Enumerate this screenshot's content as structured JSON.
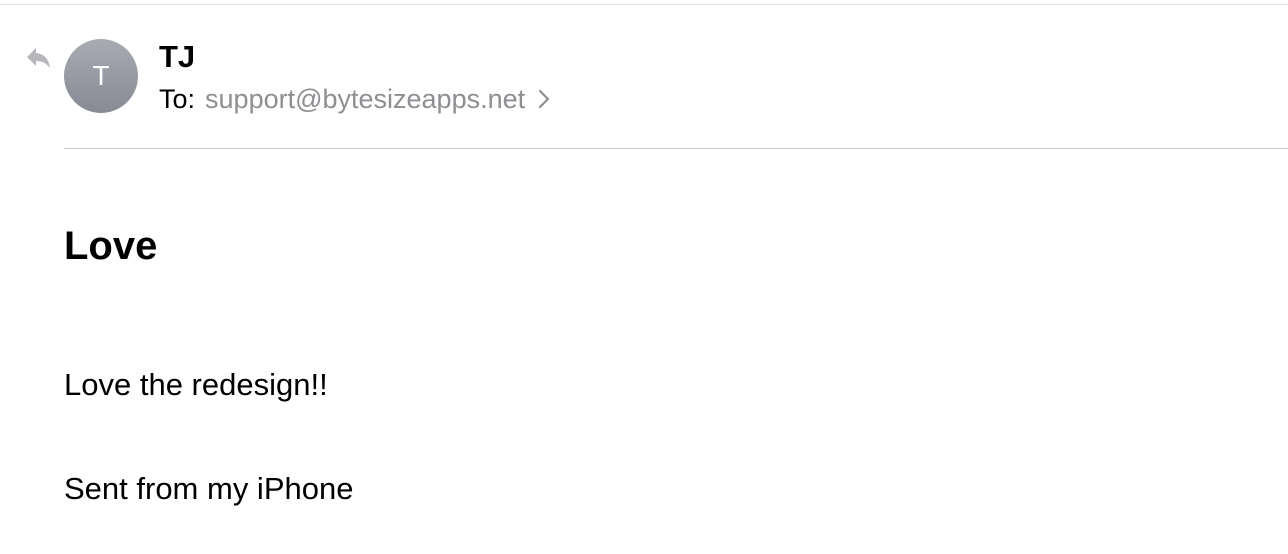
{
  "message": {
    "sender": {
      "name": "TJ",
      "avatar_initial": "T"
    },
    "recipient": {
      "label": "To:",
      "address": "support@bytesizeapps.net"
    },
    "subject": "Love",
    "body": [
      "Love the redesign!!",
      "Sent from my iPhone"
    ]
  },
  "icons": {
    "reply": "reply-arrow-icon",
    "recipient_disclosure": "chevron-right-icon"
  },
  "colors": {
    "avatar_gradient_top": "#a9abb3",
    "avatar_gradient_bottom": "#878a94",
    "secondary_text": "#8e8e93",
    "icon_gray": "#b5b5ba",
    "divider": "#c8c8cc"
  }
}
